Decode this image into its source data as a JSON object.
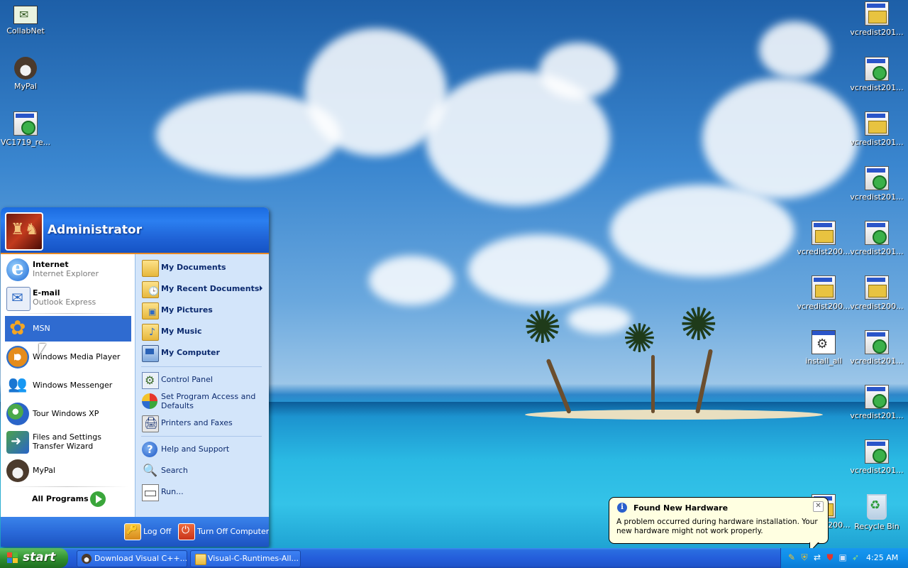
{
  "desktop": {
    "icons_left": [
      {
        "label": "CollabNet",
        "icon": "collabnet-icon"
      },
      {
        "label": "MyPal",
        "icon": "mypal-icon"
      },
      {
        "label": "VC1719_re...",
        "icon": "installer-icon"
      }
    ],
    "icons_right_col2": [
      {
        "label": "vcredist201...",
        "icon": "installer-icon"
      },
      {
        "label": "vcredist201...",
        "icon": "installer-icon"
      },
      {
        "label": "vcredist201...",
        "icon": "installer-icon"
      },
      {
        "label": "vcredist201...",
        "icon": "installer-icon"
      },
      {
        "label": "vcredist201...",
        "icon": "installer-icon"
      },
      {
        "label": "vcredist200...",
        "icon": "installer-icon"
      },
      {
        "label": "vcredist201...",
        "icon": "installer-icon"
      },
      {
        "label": "vcredist201...",
        "icon": "installer-icon"
      },
      {
        "label": "vcredist201...",
        "icon": "installer-icon"
      },
      {
        "label": "Recycle Bin",
        "icon": "recycle-bin-icon"
      }
    ],
    "icons_right_col1": [
      {
        "label": "vcredist200...",
        "icon": "installer-icon"
      },
      {
        "label": "vcredist200...",
        "icon": "installer-icon"
      },
      {
        "label": "install_all",
        "icon": "batch-file-icon"
      },
      {
        "label": "vcredist200...",
        "icon": "installer-icon"
      }
    ]
  },
  "start_menu": {
    "user": "Administrator",
    "pinned": [
      {
        "title": "Internet",
        "subtitle": "Internet Explorer",
        "icon": "internet-explorer-icon"
      },
      {
        "title": "E-mail",
        "subtitle": "Outlook Express",
        "icon": "outlook-express-icon"
      }
    ],
    "recent": [
      {
        "label": "MSN",
        "icon": "msn-icon",
        "selected": true
      },
      {
        "label": "Windows Media Player",
        "icon": "media-player-icon"
      },
      {
        "label": "Windows Messenger",
        "icon": "messenger-icon"
      },
      {
        "label": "Tour Windows XP",
        "icon": "tour-icon"
      },
      {
        "label": "Files and Settings Transfer Wizard",
        "icon": "transfer-wizard-icon"
      },
      {
        "label": "MyPal",
        "icon": "mypal-icon"
      }
    ],
    "all_programs": "All Programs",
    "right_places": [
      {
        "label": "My Documents",
        "icon": "my-documents-icon"
      },
      {
        "label": "My Recent Documents",
        "icon": "my-recent-documents-icon",
        "submenu": true
      },
      {
        "label": "My Pictures",
        "icon": "my-pictures-icon"
      },
      {
        "label": "My Music",
        "icon": "my-music-icon"
      },
      {
        "label": "My Computer",
        "icon": "my-computer-icon"
      }
    ],
    "right_settings": [
      {
        "label": "Control Panel",
        "icon": "control-panel-icon"
      },
      {
        "label": "Set Program Access and Defaults",
        "icon": "program-access-icon"
      },
      {
        "label": "Printers and Faxes",
        "icon": "printer-icon"
      }
    ],
    "right_tools": [
      {
        "label": "Help and Support",
        "icon": "help-icon"
      },
      {
        "label": "Search",
        "icon": "search-icon"
      },
      {
        "label": "Run...",
        "icon": "run-icon"
      }
    ],
    "log_off": "Log Off",
    "turn_off": "Turn Off Computer"
  },
  "taskbar": {
    "start_label": "start",
    "items": [
      {
        "label": "Download Visual C++...",
        "icon": "mypal-icon"
      },
      {
        "label": "Visual-C-Runtimes-All...",
        "icon": "folder-icon"
      }
    ],
    "clock": "4:25 AM"
  },
  "balloon": {
    "title": "Found New Hardware",
    "text": "A problem occurred during hardware installation. Your new hardware might not work properly.",
    "close_glyph": "✕",
    "info_glyph": "i"
  },
  "colors": {
    "start_button": "#3b9b3a",
    "taskbar": "#245edb",
    "start_menu_header": "#1f62d6",
    "selected_item": "#2f6bd0"
  }
}
